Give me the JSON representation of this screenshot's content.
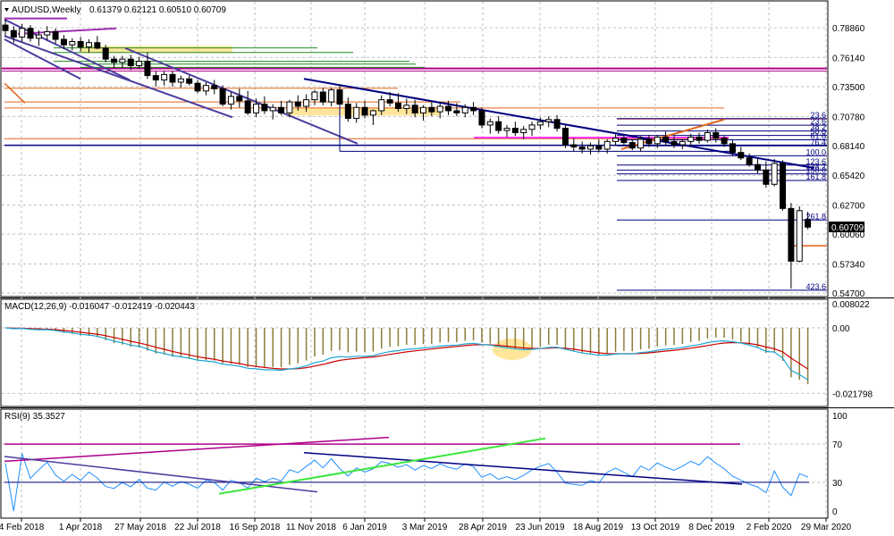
{
  "chart_data": [
    {
      "type": "candlestick",
      "title": "AUDUSD,Weekly",
      "ohlc_text": "0.61379 0.62121 0.60510 0.60709",
      "current_price": "0.60709",
      "y_ticks": [
        "0.78860",
        "0.76140",
        "0.73500",
        "0.70780",
        "0.68140",
        "0.65420",
        "0.62700",
        "0.60060",
        "0.57340",
        "0.54700"
      ],
      "ylim": [
        0.547,
        0.7886
      ],
      "x_tick_labels": [
        "4 Feb 2018",
        "1 Apr 2018",
        "27 May 2018",
        "22 Jul 2018",
        "16 Sep 2018",
        "11 Nov 2018",
        "6 Jan 2019",
        "3 Mar 2019",
        "28 Apr 2019",
        "23 Jun 2019",
        "18 Aug 2019",
        "13 Oct 2019",
        "8 Dec 2019",
        "2 Feb 2020",
        "29 Mar 2020"
      ],
      "fib_labels": [
        "23.6",
        "23.6",
        "38.2",
        "50.0",
        "61.8",
        "76.4",
        "100.0",
        "123.6",
        "138.2",
        "150.0",
        "161.8",
        "261.8",
        "423.6"
      ],
      "candles": [
        [
          0.791,
          0.796,
          0.781,
          0.786
        ],
        [
          0.786,
          0.79,
          0.775,
          0.78
        ],
        [
          0.78,
          0.792,
          0.776,
          0.788
        ],
        [
          0.788,
          0.791,
          0.776,
          0.779
        ],
        [
          0.779,
          0.786,
          0.772,
          0.782
        ],
        [
          0.782,
          0.79,
          0.777,
          0.785
        ],
        [
          0.785,
          0.788,
          0.774,
          0.778
        ],
        [
          0.778,
          0.782,
          0.769,
          0.773
        ],
        [
          0.773,
          0.779,
          0.768,
          0.776
        ],
        [
          0.776,
          0.78,
          0.767,
          0.771
        ],
        [
          0.771,
          0.778,
          0.766,
          0.775
        ],
        [
          0.775,
          0.781,
          0.769,
          0.77
        ],
        [
          0.77,
          0.773,
          0.757,
          0.76
        ],
        [
          0.76,
          0.763,
          0.752,
          0.757
        ],
        [
          0.757,
          0.763,
          0.752,
          0.76
        ],
        [
          0.76,
          0.764,
          0.75,
          0.754
        ],
        [
          0.754,
          0.762,
          0.751,
          0.758
        ],
        [
          0.758,
          0.766,
          0.742,
          0.745
        ],
        [
          0.745,
          0.749,
          0.735,
          0.741
        ],
        [
          0.741,
          0.749,
          0.736,
          0.746
        ],
        [
          0.746,
          0.749,
          0.735,
          0.739
        ],
        [
          0.739,
          0.745,
          0.734,
          0.742
        ],
        [
          0.742,
          0.745,
          0.736,
          0.738
        ],
        [
          0.738,
          0.741,
          0.729,
          0.731
        ],
        [
          0.731,
          0.739,
          0.727,
          0.736
        ],
        [
          0.736,
          0.741,
          0.728,
          0.733
        ],
        [
          0.733,
          0.736,
          0.717,
          0.719
        ],
        [
          0.719,
          0.73,
          0.714,
          0.726
        ],
        [
          0.726,
          0.733,
          0.716,
          0.722
        ],
        [
          0.722,
          0.731,
          0.709,
          0.711
        ],
        [
          0.711,
          0.724,
          0.707,
          0.719
        ],
        [
          0.719,
          0.726,
          0.71,
          0.713
        ],
        [
          0.713,
          0.719,
          0.705,
          0.716
        ],
        [
          0.716,
          0.722,
          0.709,
          0.711
        ],
        [
          0.711,
          0.723,
          0.707,
          0.721
        ],
        [
          0.721,
          0.727,
          0.713,
          0.717
        ],
        [
          0.717,
          0.728,
          0.712,
          0.723
        ],
        [
          0.723,
          0.732,
          0.718,
          0.73
        ],
        [
          0.73,
          0.734,
          0.718,
          0.721
        ],
        [
          0.721,
          0.734,
          0.717,
          0.732
        ],
        [
          0.732,
          0.737,
          0.717,
          0.719
        ],
        [
          0.719,
          0.725,
          0.703,
          0.706
        ],
        [
          0.706,
          0.72,
          0.702,
          0.716
        ],
        [
          0.716,
          0.722,
          0.706,
          0.709
        ],
        [
          0.709,
          0.714,
          0.7,
          0.713
        ],
        [
          0.713,
          0.727,
          0.709,
          0.723
        ],
        [
          0.723,
          0.73,
          0.717,
          0.72
        ],
        [
          0.72,
          0.729,
          0.712,
          0.715
        ],
        [
          0.715,
          0.724,
          0.71,
          0.718
        ],
        [
          0.718,
          0.723,
          0.707,
          0.711
        ],
        [
          0.711,
          0.718,
          0.704,
          0.716
        ],
        [
          0.716,
          0.722,
          0.708,
          0.712
        ],
        [
          0.712,
          0.721,
          0.706,
          0.717
        ],
        [
          0.717,
          0.722,
          0.709,
          0.713
        ],
        [
          0.713,
          0.72,
          0.708,
          0.711
        ],
        [
          0.711,
          0.719,
          0.707,
          0.716
        ],
        [
          0.716,
          0.721,
          0.709,
          0.713
        ],
        [
          0.713,
          0.716,
          0.697,
          0.7
        ],
        [
          0.7,
          0.706,
          0.692,
          0.703
        ],
        [
          0.703,
          0.708,
          0.692,
          0.695
        ],
        [
          0.695,
          0.7,
          0.689,
          0.697
        ],
        [
          0.697,
          0.703,
          0.69,
          0.693
        ],
        [
          0.693,
          0.699,
          0.687,
          0.696
        ],
        [
          0.696,
          0.703,
          0.69,
          0.7
        ],
        [
          0.7,
          0.707,
          0.696,
          0.703
        ],
        [
          0.703,
          0.708,
          0.698,
          0.705
        ],
        [
          0.705,
          0.709,
          0.694,
          0.697
        ],
        [
          0.697,
          0.7,
          0.679,
          0.682
        ],
        [
          0.682,
          0.688,
          0.676,
          0.68
        ],
        [
          0.68,
          0.685,
          0.674,
          0.678
        ],
        [
          0.678,
          0.684,
          0.673,
          0.681
        ],
        [
          0.681,
          0.687,
          0.675,
          0.678
        ],
        [
          0.678,
          0.687,
          0.674,
          0.685
        ],
        [
          0.685,
          0.692,
          0.681,
          0.688
        ],
        [
          0.688,
          0.69,
          0.681,
          0.684
        ],
        [
          0.684,
          0.687,
          0.677,
          0.679
        ],
        [
          0.679,
          0.69,
          0.676,
          0.687
        ],
        [
          0.687,
          0.691,
          0.68,
          0.683
        ],
        [
          0.683,
          0.691,
          0.679,
          0.689
        ],
        [
          0.689,
          0.694,
          0.682,
          0.685
        ],
        [
          0.685,
          0.69,
          0.679,
          0.682
        ],
        [
          0.682,
          0.687,
          0.678,
          0.685
        ],
        [
          0.685,
          0.692,
          0.68,
          0.689
        ],
        [
          0.689,
          0.693,
          0.683,
          0.686
        ],
        [
          0.686,
          0.696,
          0.684,
          0.693
        ],
        [
          0.693,
          0.697,
          0.684,
          0.688
        ],
        [
          0.688,
          0.69,
          0.68,
          0.683
        ],
        [
          0.683,
          0.686,
          0.672,
          0.675
        ],
        [
          0.675,
          0.68,
          0.668,
          0.67
        ],
        [
          0.67,
          0.674,
          0.662,
          0.664
        ],
        [
          0.664,
          0.67,
          0.656,
          0.659
        ],
        [
          0.659,
          0.667,
          0.643,
          0.646
        ],
        [
          0.646,
          0.669,
          0.644,
          0.665
        ],
        [
          0.665,
          0.668,
          0.622,
          0.624
        ],
        [
          0.624,
          0.629,
          0.551,
          0.576
        ],
        [
          0.576,
          0.626,
          0.575,
          0.622
        ],
        [
          0.614,
          0.621,
          0.605,
          0.607
        ]
      ]
    },
    {
      "type": "line",
      "title": "MACD(12,26,9) -0.016047 -0.012419 -0.020443",
      "y_ticks": [
        "0.008022",
        "0.00",
        "-0.021798"
      ],
      "ylim": [
        -0.0228,
        0.0085
      ]
    },
    {
      "type": "line",
      "title": "RSI(9) 35.3527",
      "y_ticks": [
        "100",
        "70",
        "30",
        "0"
      ],
      "ylim": [
        0,
        100
      ]
    }
  ],
  "colors": {
    "candle": "#000000",
    "grid": "#c0c0c0",
    "macd_line": "#cc0000",
    "signal_line": "#1ea6d6",
    "histogram": "#8b7d3a",
    "rsi_line": "#1e90ff",
    "fib": "#000080",
    "highlight": "#ffe082"
  }
}
